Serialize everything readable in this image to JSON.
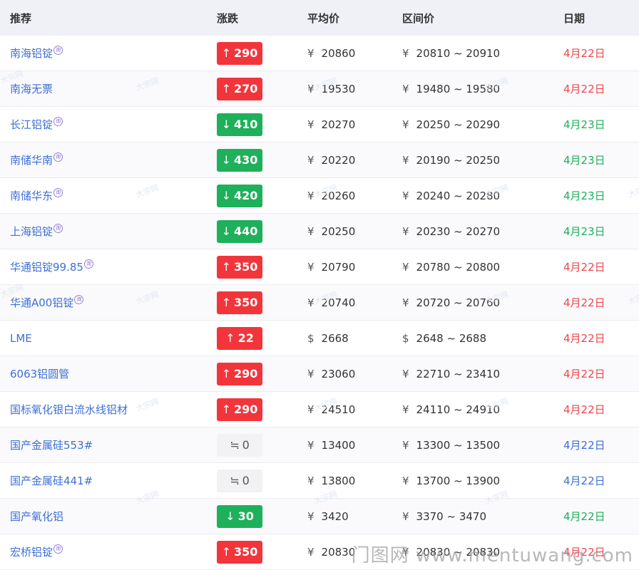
{
  "header": {
    "name": "推荐",
    "change": "涨跌",
    "avg": "平均价",
    "range": "区间价",
    "date": "日期"
  },
  "badge_text": "询",
  "watermark_text": "大宗网",
  "site_watermark": "门图网 www.mentuwang.com",
  "colors": {
    "up": "#f2353b",
    "down": "#1eb05a",
    "flat": "#f2f2f4",
    "link": "#3d6fd6",
    "date_red": "#f0454a",
    "date_green": "#1eb05a",
    "date_blue": "#3d6fd6"
  },
  "rows": [
    {
      "name": "南海铝锭",
      "badge": true,
      "dir": "up",
      "arrow": "↑",
      "change": "290",
      "cur": "¥",
      "avg": "20860",
      "range": "20810 ~ 20910",
      "date": "4月22日",
      "date_color": "red"
    },
    {
      "name": "南海无票",
      "badge": false,
      "dir": "up",
      "arrow": "↑",
      "change": "270",
      "cur": "¥",
      "avg": "19530",
      "range": "19480 ~ 19580",
      "date": "4月22日",
      "date_color": "red"
    },
    {
      "name": "长江铝锭",
      "badge": true,
      "dir": "down",
      "arrow": "↓",
      "change": "410",
      "cur": "¥",
      "avg": "20270",
      "range": "20250 ~ 20290",
      "date": "4月23日",
      "date_color": "green"
    },
    {
      "name": "南储华南",
      "badge": true,
      "dir": "down",
      "arrow": "↓",
      "change": "430",
      "cur": "¥",
      "avg": "20220",
      "range": "20190 ~ 20250",
      "date": "4月23日",
      "date_color": "green"
    },
    {
      "name": "南储华东",
      "badge": true,
      "dir": "down",
      "arrow": "↓",
      "change": "420",
      "cur": "¥",
      "avg": "20260",
      "range": "20240 ~ 20280",
      "date": "4月23日",
      "date_color": "green"
    },
    {
      "name": "上海铝锭",
      "badge": true,
      "dir": "down",
      "arrow": "↓",
      "change": "440",
      "cur": "¥",
      "avg": "20250",
      "range": "20230 ~ 20270",
      "date": "4月23日",
      "date_color": "green"
    },
    {
      "name": "华通铝锭99.85",
      "badge": true,
      "dir": "up",
      "arrow": "↑",
      "change": "350",
      "cur": "¥",
      "avg": "20790",
      "range": "20780 ~ 20800",
      "date": "4月22日",
      "date_color": "red"
    },
    {
      "name": "华通A00铝锭",
      "badge": true,
      "dir": "up",
      "arrow": "↑",
      "change": "350",
      "cur": "¥",
      "avg": "20740",
      "range": "20720 ~ 20760",
      "date": "4月22日",
      "date_color": "red"
    },
    {
      "name": "LME",
      "badge": false,
      "dir": "up",
      "arrow": "↑",
      "change": "22",
      "cur": "$",
      "avg": "2668",
      "range": "2648 ~ 2688",
      "date": "4月22日",
      "date_color": "red"
    },
    {
      "name": "6063铝圆管",
      "badge": false,
      "dir": "up",
      "arrow": "↑",
      "change": "290",
      "cur": "¥",
      "avg": "23060",
      "range": "22710 ~ 23410",
      "date": "4月22日",
      "date_color": "red"
    },
    {
      "name": "国标氧化银白流水线铝材",
      "badge": false,
      "dir": "up",
      "arrow": "↑",
      "change": "290",
      "cur": "¥",
      "avg": "24510",
      "range": "24110 ~ 24910",
      "date": "4月22日",
      "date_color": "red"
    },
    {
      "name": "国产金属硅553#",
      "badge": false,
      "dir": "flat",
      "arrow": "≒",
      "change": "0",
      "cur": "¥",
      "avg": "13400",
      "range": "13300 ~ 13500",
      "date": "4月22日",
      "date_color": "blue"
    },
    {
      "name": "国产金属硅441#",
      "badge": false,
      "dir": "flat",
      "arrow": "≒",
      "change": "0",
      "cur": "¥",
      "avg": "13800",
      "range": "13700 ~ 13900",
      "date": "4月22日",
      "date_color": "blue"
    },
    {
      "name": "国产氧化铝",
      "badge": false,
      "dir": "down",
      "arrow": "↓",
      "change": "30",
      "cur": "¥",
      "avg": "3420",
      "range": "3370 ~ 3470",
      "date": "4月22日",
      "date_color": "green"
    },
    {
      "name": "宏桥铝锭",
      "badge": true,
      "dir": "up",
      "arrow": "↑",
      "change": "350",
      "cur": "¥",
      "avg": "20830",
      "range": "20830 ~ 20830",
      "date": "4月22日",
      "date_color": "red"
    }
  ]
}
